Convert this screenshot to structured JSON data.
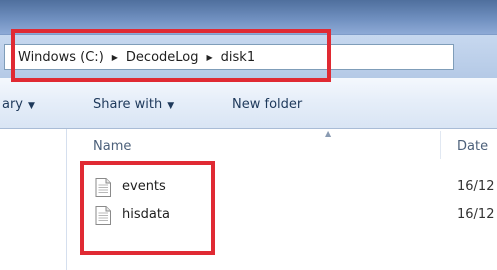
{
  "breadcrumb": {
    "segments": [
      "Windows (C:)",
      "DecodeLog",
      "disk1"
    ],
    "separator": "▶"
  },
  "toolbar": {
    "library_partial": "ary",
    "share_with": "Share with",
    "new_folder": "New folder",
    "dropdown_glyph": "▼"
  },
  "columns": {
    "name": "Name",
    "date": "Date"
  },
  "files": [
    {
      "name": "events",
      "date_partial": "16/12"
    },
    {
      "name": "hisdata",
      "date_partial": "16/12"
    }
  ],
  "colors": {
    "highlight": "#e02a33",
    "toolbar_text": "#1e395b"
  }
}
